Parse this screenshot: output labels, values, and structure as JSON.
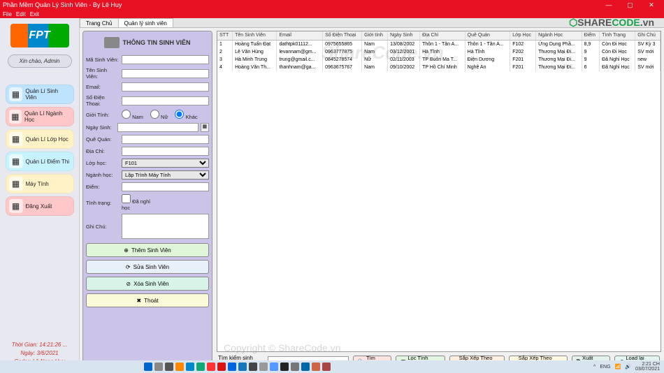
{
  "window": {
    "title": "Phần Mềm Quản Lý Sinh Viên - By Lê Huy"
  },
  "menus": {
    "file": "File",
    "edit": "Edit",
    "exit": "Exit"
  },
  "sidebar": {
    "greeting": "Xin chào, Admin",
    "nav": [
      {
        "label": "Quản Lí Sinh Viên",
        "cls": "nb-blue"
      },
      {
        "label": "Quản Lí Ngành Học",
        "cls": "nb-red"
      },
      {
        "label": "Quản Lí Lớp Học",
        "cls": "nb-yel"
      },
      {
        "label": "Quản Lí Điểm Thi",
        "cls": "nb-cyan"
      },
      {
        "label": "Máy Tính",
        "cls": "nb-yel"
      },
      {
        "label": "Đăng Xuất",
        "cls": "nb-red"
      }
    ],
    "footer": {
      "time": "Thời Gian: 14:21:26 ...",
      "date": "Ngày: 3/6/2021",
      "coder": "Coder: Lê Ngọc Huy"
    }
  },
  "tabs": {
    "t1": "Trang Chủ",
    "t2": "Quản lý sinh viên"
  },
  "form": {
    "title": "THÔNG TIN SINH VIÊN",
    "labels": {
      "ma": "Mã Sinh Viên:",
      "ten": "Tên Sinh Viên:",
      "email": "Email:",
      "sdt": "Số Điện Thoại:",
      "gt": "Giới Tính:",
      "ns": "Ngày Sinh:",
      "qq": "Quê Quán:",
      "dc": "Địa Chỉ:",
      "lop": "Lớp học:",
      "nganh": "Ngành học:",
      "diem": "Điểm:",
      "tt": "Tình trạng:",
      "ghi": "Ghi Chú:"
    },
    "gender": {
      "nam": "Nam",
      "nu": "Nữ",
      "khac": "Khác"
    },
    "lop_value": "F101",
    "nganh_value": "Lập Trình Máy Tính",
    "check_label": "Đã nghỉ học",
    "btn_add": "Thêm Sinh Viên",
    "btn_edit": "Sửa Sinh Viên",
    "btn_del": "Xóa Sinh Viên",
    "btn_exit": "Thoát"
  },
  "table": {
    "headers": [
      "STT",
      "Tên Sinh Viên",
      "Email",
      "Số Điện Thoại",
      "Giới tính",
      "Ngày Sinh",
      "Địa Chỉ",
      "Quê Quán",
      "Lớp Học",
      "Ngành Học",
      "Điểm",
      "Tình Trạng",
      "Ghi Chú"
    ],
    "rows": [
      [
        "1",
        "Hoàng Tuấn Đạt",
        "dathtpk01112...",
        "0975655865",
        "Nam",
        "13/08/2002",
        "Thôn 1 - Tân A...",
        "Thôn 1 - Tân A...",
        "F102",
        "Ứng Dụng Phầ...",
        "8,9",
        "Còn Đi Học",
        "SV Kỳ 3"
      ],
      [
        "2",
        "Lê Văn Hùng",
        "levannam@gm...",
        "0963777875",
        "Nam",
        "03/12/2001",
        "Hà Tĩnh",
        "Hà Tĩnh",
        "F202",
        "Thương Mại Đi...",
        "9",
        "Còn Đi Học",
        "SV mới"
      ],
      [
        "3",
        "Hà Minh Trung",
        "trung@gmail.c...",
        "0845278574",
        "Nữ",
        "02/11/2003",
        "TP Buôn Ma T...",
        "Điện Dương",
        "F201",
        "Thương Mại Đi...",
        "9",
        "Đã Nghỉ Học",
        "new"
      ],
      [
        "4",
        "Hoàng Văn Th...",
        "thanhnam@ga...",
        "0963675767",
        "Nam",
        "09/10/2002",
        "TP Hồ Chí Minh",
        "Nghệ An",
        "F201",
        "Thương Mại Đi...",
        "6",
        "Đã Nghỉ Học",
        "SV mới"
      ]
    ]
  },
  "search": {
    "label": "Tìm kiếm sinh viên:",
    "btn_search": "Tìm Kiếm",
    "btn_filter": "Lọc Tình Trạng",
    "btn_sort_name": "Sắp Xếp Theo Tên",
    "btn_sort_score": "Sắp Xếp Theo Điểm",
    "btn_excel": "Xuất Excel",
    "btn_reload": "Load lại bảng"
  },
  "watermark": "ShareCode.vn",
  "watermark2": "Copyright © ShareCode.vn",
  "corner": {
    "p1": "SHARE",
    "p2": "CODE",
    "p3": ".vn"
  },
  "tray": {
    "lang": "ENG",
    "time": "2:21 CH",
    "date": "03/07/2021"
  }
}
